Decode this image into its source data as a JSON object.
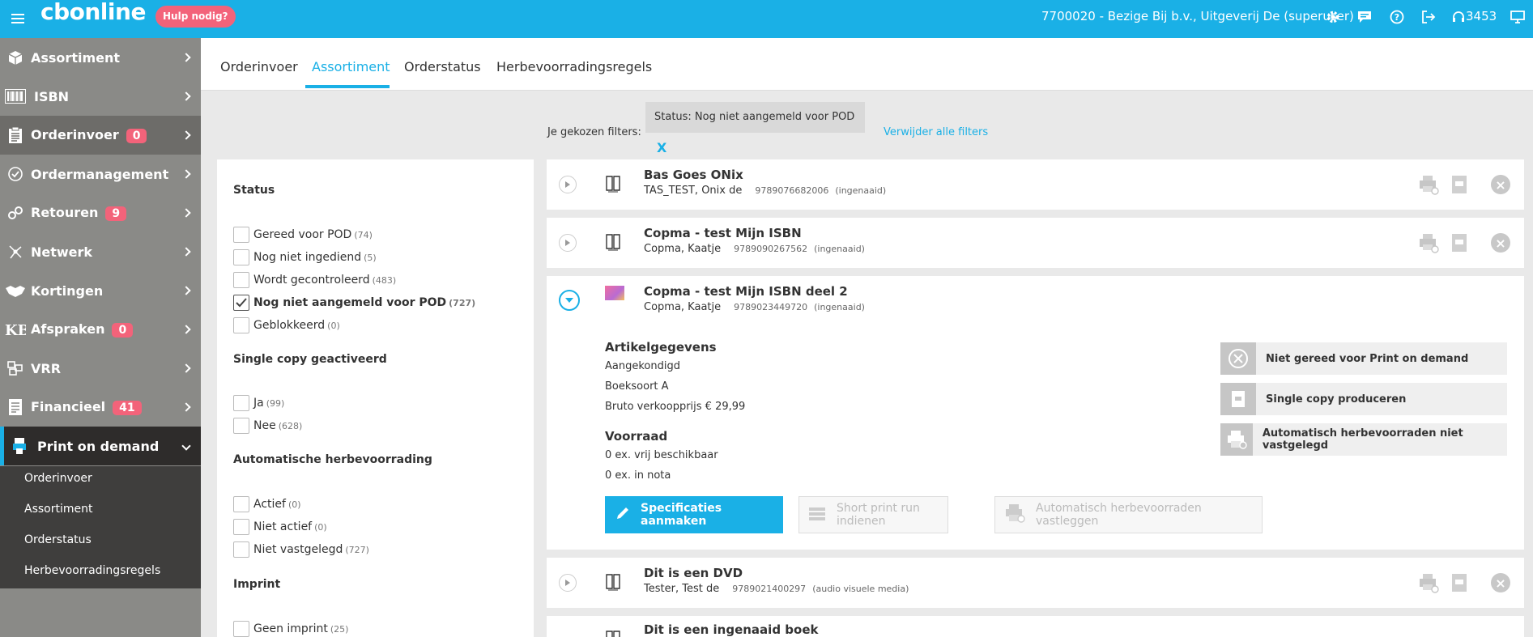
{
  "topbar": {
    "logo": "cbonline",
    "help_label": "Hulp nodig?",
    "user": "7700020 - Bezige Bij b.v., Uitgeverij De (superuser)",
    "count": "3453",
    "icons": [
      "gear-icon",
      "chat-icon",
      "help-icon",
      "logout-icon",
      "headset-icon",
      "monitor-icon"
    ]
  },
  "sidebar": {
    "items": [
      {
        "label": "Assortiment",
        "icon": "box-icon"
      },
      {
        "label": "ISBN",
        "icon": "barcode-icon"
      },
      {
        "label": "Orderinvoer",
        "icon": "clipboard-icon",
        "badge": "0"
      },
      {
        "label": "Ordermanagement",
        "icon": "check-circle-icon"
      },
      {
        "label": "Retouren",
        "icon": "return-icon",
        "badge": "9"
      },
      {
        "label": "Netwerk",
        "icon": "network-icon"
      },
      {
        "label": "Kortingen",
        "icon": "handshake-icon"
      },
      {
        "label": "Afspraken",
        "icon": "kb-icon",
        "badge": "0"
      },
      {
        "label": "VRR",
        "icon": "boxes-icon"
      },
      {
        "label": "Financieel",
        "icon": "invoice-icon",
        "badge": "41"
      },
      {
        "label": "Print on demand",
        "icon": "printer-hand-icon"
      }
    ],
    "sub_items": [
      "Orderinvoer",
      "Assortiment",
      "Orderstatus",
      "Herbevoorradingsregels"
    ]
  },
  "tabs": [
    "Orderinvoer",
    "Assortiment",
    "Orderstatus",
    "Herbevoorradingsregels"
  ],
  "active_tab": "Assortiment",
  "filterbar": {
    "label": "Je gekozen filters:",
    "chip": "Status: Nog niet aangemeld voor POD",
    "chip_close": "X",
    "remove_all": "Verwijder alle filters"
  },
  "filters": {
    "status": {
      "title": "Status",
      "options": [
        {
          "label": "Gereed voor POD",
          "count": "(74)"
        },
        {
          "label": "Nog niet ingediend",
          "count": "(5)"
        },
        {
          "label": "Wordt gecontroleerd",
          "count": "(483)"
        },
        {
          "label": "Nog niet aangemeld voor POD",
          "count": "(727)",
          "checked": true
        },
        {
          "label": "Geblokkeerd",
          "count": "(0)"
        }
      ]
    },
    "single_copy": {
      "title": "Single copy geactiveerd",
      "options": [
        {
          "label": "Ja",
          "count": "(99)"
        },
        {
          "label": "Nee",
          "count": "(628)"
        }
      ]
    },
    "auto": {
      "title": "Automatische herbevoorrading",
      "options": [
        {
          "label": "Actief",
          "count": "(0)"
        },
        {
          "label": "Niet actief",
          "count": "(0)"
        },
        {
          "label": "Niet vastgelegd",
          "count": "(727)"
        }
      ]
    },
    "imprint": {
      "title": "Imprint",
      "options": [
        {
          "label": "Geen imprint",
          "count": "(25)"
        }
      ]
    }
  },
  "results": [
    {
      "title": "Bas Goes ONix",
      "author": "TAS_TEST, Onix de",
      "isbn": "9789076682006",
      "kind": "(ingenaaid)"
    },
    {
      "title": "Copma - test Mijn ISBN",
      "author": "Copma, Kaatje",
      "isbn": "9789090267562",
      "kind": "(ingenaaid)"
    },
    {
      "title": "Copma - test Mijn ISBN deel 2",
      "author": "Copma, Kaatje",
      "isbn": "9789023449720",
      "kind": "(ingenaaid)"
    },
    {
      "title": "Dit is een DVD",
      "author": "Tester, Test de",
      "isbn": "9789021400297",
      "kind": "(audio visuele media)"
    },
    {
      "title": "Dit is een ingenaaid boek"
    }
  ],
  "detail": {
    "article_title": "Artikelgegevens",
    "article_lines": [
      "Aangekondigd",
      "Boeksoort A",
      "Bruto verkoopprijs € 29,99"
    ],
    "stock_title": "Voorraad",
    "stock_lines": [
      "0 ex. vrij beschikbaar",
      "0 ex. in nota"
    ],
    "btn_specs": "Specificaties aanmaken",
    "btn_short": "Short print run indienen",
    "btn_auto": "Automatisch herbevoorraden vastleggen",
    "side_actions": [
      "Niet gereed voor Print on demand",
      "Single copy produceren",
      "Automatisch herbevoorraden niet vastgelegd"
    ]
  }
}
